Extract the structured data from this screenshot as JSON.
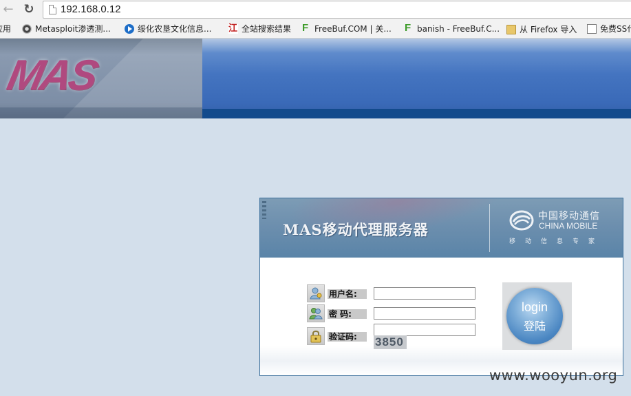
{
  "browser": {
    "back_icon": "←",
    "reload_icon": "↻",
    "url": "192.168.0.12",
    "bookmarks": [
      {
        "label": "应用",
        "icon": "apps-icon"
      },
      {
        "label": "Metasploit渗透测...",
        "icon": "metasploit-icon"
      },
      {
        "label": "绥化农垦文化信息...",
        "icon": "play-icon"
      },
      {
        "label": "全站搜索结果",
        "icon": "search-site-icon"
      },
      {
        "label": "FreeBuf.COM | 关...",
        "icon": "freebuf-icon"
      },
      {
        "label": "banish - FreeBuf.C...",
        "icon": "freebuf-icon"
      },
      {
        "label": "从 Firefox 导入",
        "icon": "folder-icon"
      },
      {
        "label": "免费SS代",
        "icon": "page-icon"
      }
    ]
  },
  "header": {
    "logo_text": "MAS",
    "left_color": "#7d8ea6",
    "right_color": "#4474c0",
    "stripe_color": "#124a8c"
  },
  "panel": {
    "title": "MAS移动代理服务器",
    "brand_cn": "中国移动通信",
    "brand_en": "CHINA MOBILE",
    "slogan": "移动信息专家",
    "username_label": "用户名:",
    "password_label": "密    码:",
    "captcha_label": "验证码:",
    "username_value": "",
    "password_value": "",
    "captcha_value": "",
    "captcha_code": "3850",
    "login_en": "login",
    "login_cn": "登陆"
  },
  "watermark": "www.wooyun.org"
}
